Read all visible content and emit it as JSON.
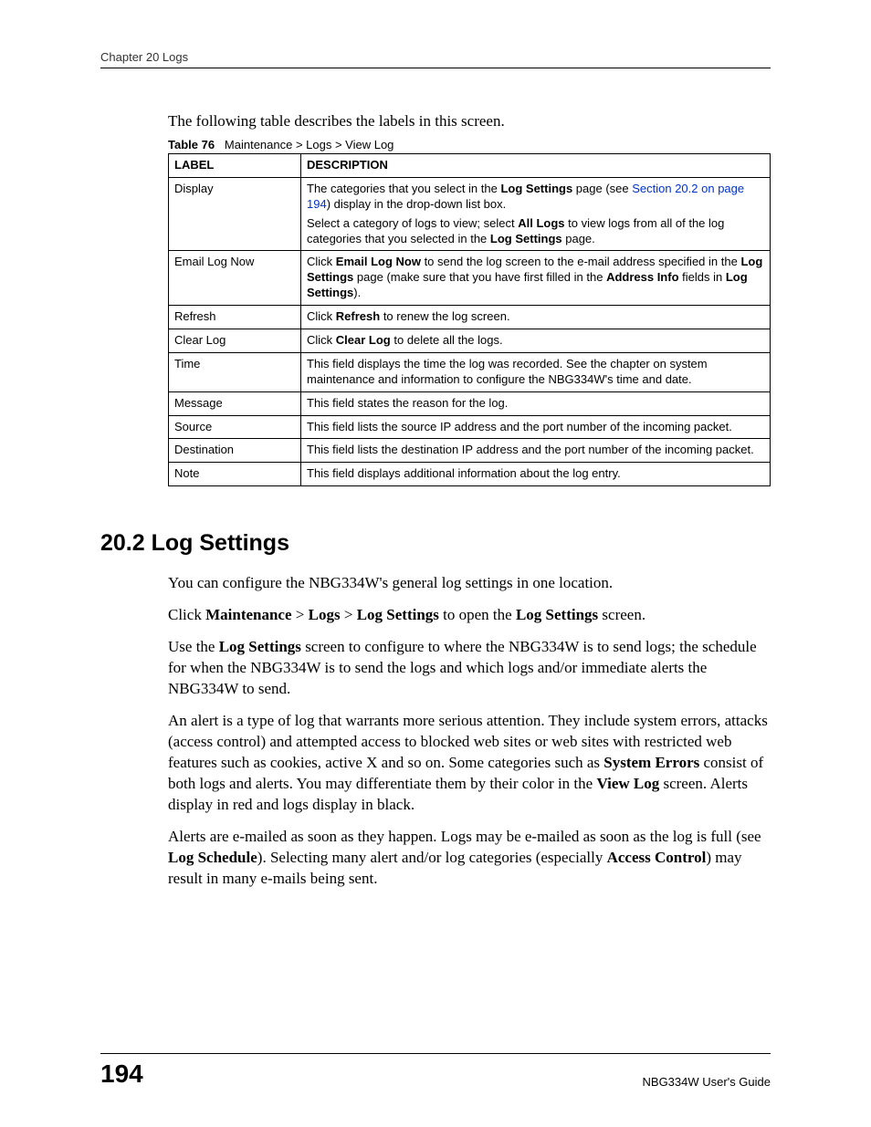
{
  "chapter_header": "Chapter 20 Logs",
  "intro": "The following table describes the labels in this screen.",
  "table_caption_label": "Table 76",
  "table_caption_text": "Maintenance > Logs > View Log",
  "table": {
    "headers": {
      "label": "LABEL",
      "description": "DESCRIPTION"
    },
    "rows": [
      {
        "label": "Display",
        "desc_pre1": "The categories that you select in the ",
        "desc_bold1": "Log Settings",
        "desc_mid1": " page (see ",
        "desc_link": "Section 20.2 on page 194",
        "desc_post1": ") display in the drop-down list box.",
        "desc_pre2": "Select a category of logs to view; select ",
        "desc_bold2": "All Logs",
        "desc_mid2": " to view logs from all of the log categories that you selected in the ",
        "desc_bold3": "Log Settings",
        "desc_post2": " page."
      },
      {
        "label": "Email Log Now",
        "desc_pre1": "Click ",
        "desc_bold1": "Email Log Now",
        "desc_mid1": " to send the log screen to the e-mail address specified in the ",
        "desc_bold2": "Log Settings",
        "desc_mid2": " page (make sure that you have first filled in the ",
        "desc_bold3": "Address Info",
        "desc_mid3": " fields in ",
        "desc_bold4": "Log Settings",
        "desc_post1": ")."
      },
      {
        "label": "Refresh",
        "desc_pre1": "Click ",
        "desc_bold1": "Refresh",
        "desc_post1": " to renew the log screen."
      },
      {
        "label": "Clear Log",
        "desc_pre1": "Click ",
        "desc_bold1": "Clear Log",
        "desc_post1": " to delete all the logs."
      },
      {
        "label": "Time",
        "desc_plain": "This field displays the time the log was recorded. See the chapter on system maintenance and information to configure the NBG334W's time and date."
      },
      {
        "label": "Message",
        "desc_plain": "This field states the reason for the log."
      },
      {
        "label": "Source",
        "desc_plain": "This field lists the source IP address and the port number of the incoming packet."
      },
      {
        "label": "Destination",
        "desc_plain": "This field lists the destination IP address and the port number of the incoming packet."
      },
      {
        "label": "Note",
        "desc_plain": "This field displays additional information about the log entry."
      }
    ]
  },
  "section_heading": "20.2  Log Settings",
  "para1": "You can configure the NBG334W's general log settings in one location.",
  "para2": {
    "t1": "Click ",
    "b1": "Maintenance",
    "t2": " > ",
    "b2": "Logs",
    "t3": " > ",
    "b3": "Log Settings",
    "t4": " to open the ",
    "b4": "Log Settings",
    "t5": " screen."
  },
  "para3": {
    "t1": "Use the ",
    "b1": "Log Settings",
    "t2": " screen to configure to where the NBG334W is to send logs; the schedule for when the NBG334W is to send the logs and which logs and/or immediate alerts the NBG334W to send."
  },
  "para4": {
    "t1": "An alert is a type of log that warrants more serious attention. They include system errors, attacks (access control) and attempted access to blocked web sites or web sites with restricted web features such as cookies, active X and so on. Some categories such as ",
    "b1": "System Errors",
    "t2": " consist of both logs and alerts. You may differentiate them by their color in the ",
    "b2": "View Log",
    "t3": " screen. Alerts display in red and logs display in black."
  },
  "para5": {
    "t1": "Alerts are e-mailed as soon as they happen. Logs may be e-mailed as soon as the log is full (see ",
    "b1": "Log Schedule",
    "t2": "). Selecting many alert and/or log categories (especially ",
    "b2": "Access Control",
    "t3": ") may result in many e-mails being sent."
  },
  "footer": {
    "page_num": "194",
    "guide": "NBG334W User's Guide"
  }
}
